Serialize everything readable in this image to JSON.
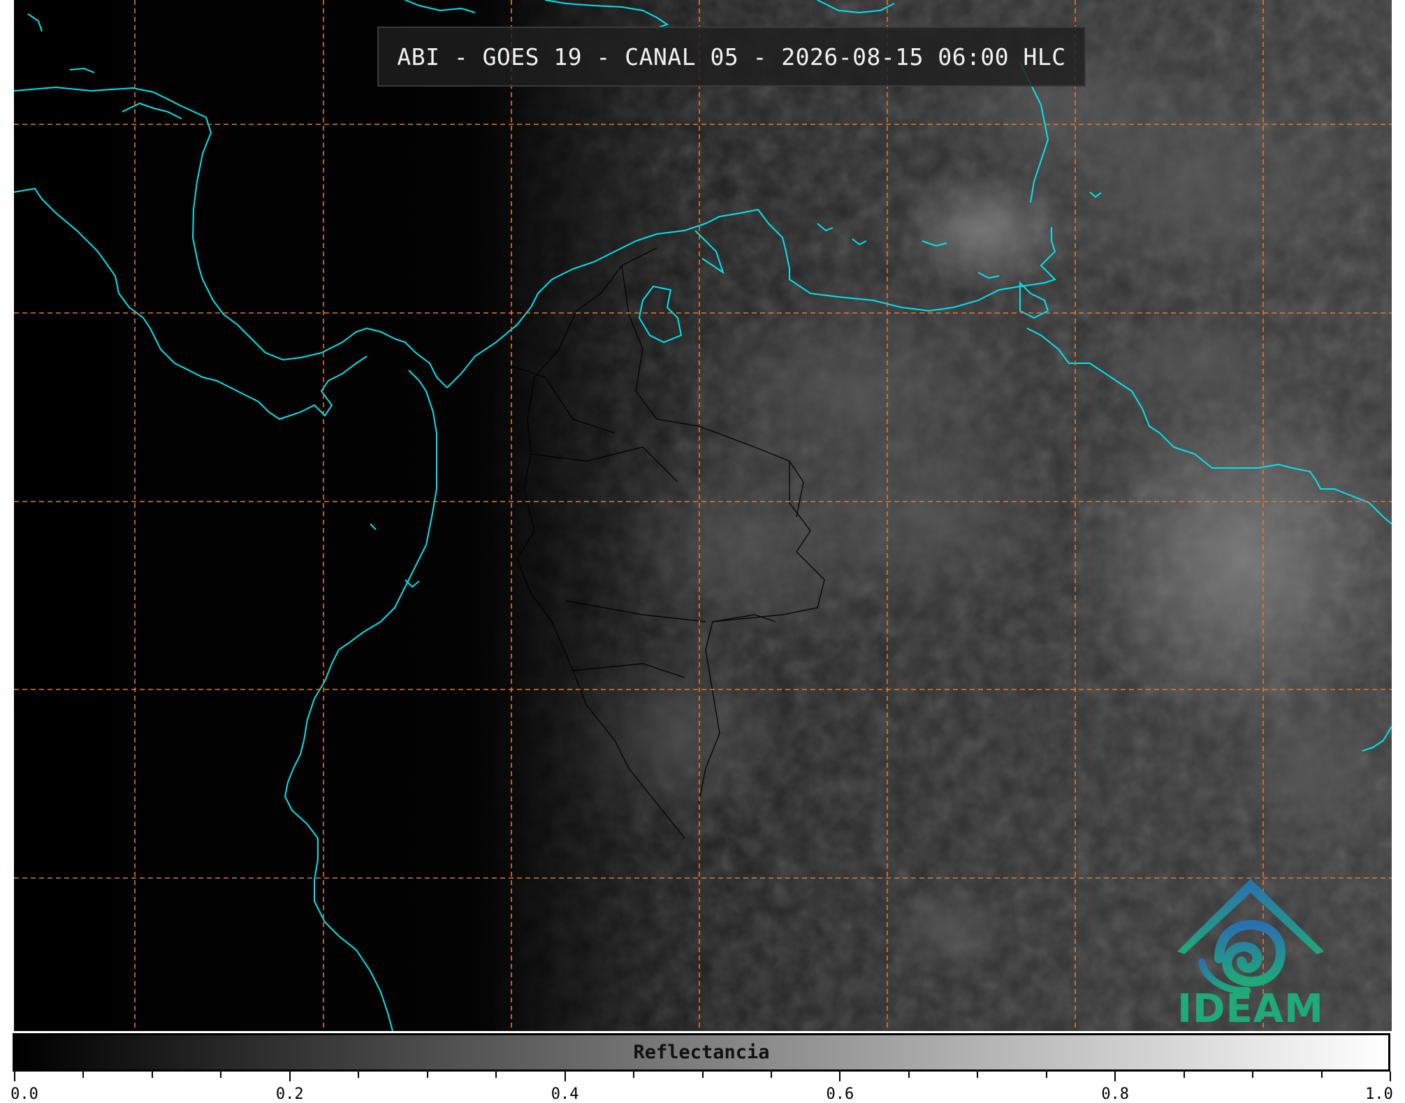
{
  "title": "ABI - GOES 19 - CANAL 05 - 2026-08-15 06:00 HLC",
  "logo": {
    "label": "IDEAM",
    "color_top": "#2a6fb0",
    "color_bottom": "#1faa7a"
  },
  "colorbar": {
    "label": "Reflectancia",
    "min": 0.0,
    "max": 1.0,
    "colormap": "gray",
    "major_ticks": [
      "0.0",
      "0.2",
      "0.4",
      "0.6",
      "0.8",
      "1.0"
    ],
    "minor_tick_step": 0.05
  },
  "colors": {
    "coastline": "#00e5ee",
    "graticule": "#e07b30",
    "borders": "#000000",
    "background": "#000000"
  },
  "layers": {
    "coastlines": true,
    "country_borders": true,
    "graticule": true
  }
}
